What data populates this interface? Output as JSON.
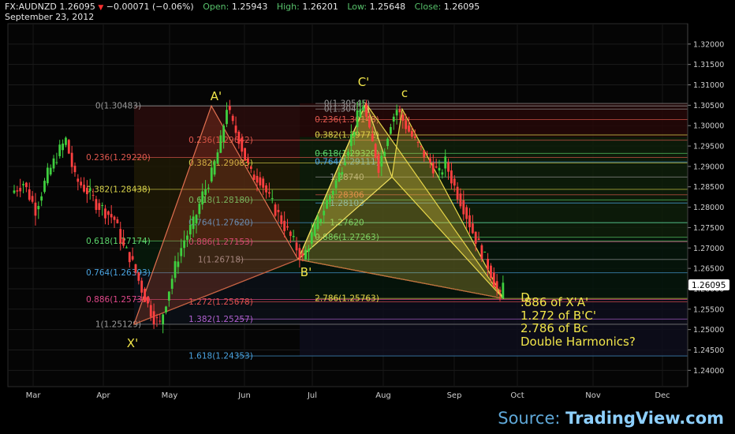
{
  "header": {
    "symbol": "FX:AUDNZD",
    "price": "1.26095",
    "change": "−0.00071 (−0.06%)",
    "open_label": "Open:",
    "open": "1.25943",
    "high_label": "High:",
    "high": "1.26201",
    "low_label": "Low:",
    "low": "1.25648",
    "close_label": "Close:",
    "close": "1.26095",
    "date": "September 23, 2012"
  },
  "price_tag": "1.26095",
  "colors": {
    "up": "#3fcf3f",
    "down": "#ff4040",
    "bull_pattern": "#e8d84a",
    "bear_pattern": "#cf6a3e",
    "price_tag_bg": "#ffffff"
  },
  "chart_data": {
    "type": "candlestick",
    "x_axis": {
      "ticks": [
        "Mar",
        "Apr",
        "May",
        "Jun",
        "Jul",
        "Aug",
        "Sep",
        "Oct",
        "Nov",
        "Dec"
      ]
    },
    "y_axis": {
      "min": 1.236,
      "max": 1.325,
      "ticks": [
        "1.32000",
        "1.31500",
        "1.31000",
        "1.30500",
        "1.30000",
        "1.29500",
        "1.29000",
        "1.28500",
        "1.28000",
        "1.27500",
        "1.27000",
        "1.26500",
        "1.26000",
        "1.25500",
        "1.25000",
        "1.24500",
        "1.24000"
      ]
    },
    "price_path": [
      [
        1.2835,
        0
      ],
      [
        1.286,
        4
      ],
      [
        1.2795,
        8
      ],
      [
        1.288,
        12
      ],
      [
        1.294,
        16
      ],
      [
        1.2965,
        18
      ],
      [
        1.287,
        21
      ],
      [
        1.284,
        25
      ],
      [
        1.281,
        28
      ],
      [
        1.279,
        31
      ],
      [
        1.277,
        34
      ],
      [
        1.27,
        37
      ],
      [
        1.268,
        39
      ],
      [
        1.264,
        41
      ],
      [
        1.26,
        43
      ],
      [
        1.256,
        45
      ],
      [
        1.253,
        47
      ],
      [
        1.2513,
        49
      ],
      [
        1.26,
        52
      ],
      [
        1.268,
        55
      ],
      [
        1.272,
        57
      ],
      [
        1.276,
        60
      ],
      [
        1.283,
        63
      ],
      [
        1.288,
        66
      ],
      [
        1.296,
        69
      ],
      [
        1.3048,
        71
      ],
      [
        1.3,
        73
      ],
      [
        1.297,
        75
      ],
      [
        1.292,
        77
      ],
      [
        1.288,
        79
      ],
      [
        1.287,
        82
      ],
      [
        1.282,
        85
      ],
      [
        1.278,
        88
      ],
      [
        1.274,
        91
      ],
      [
        1.27,
        94
      ],
      [
        1.2672,
        96
      ],
      [
        1.273,
        99
      ],
      [
        1.278,
        102
      ],
      [
        1.283,
        105
      ],
      [
        1.288,
        108
      ],
      [
        1.295,
        111
      ],
      [
        1.302,
        114
      ],
      [
        1.3054,
        116
      ],
      [
        1.298,
        118
      ],
      [
        1.293,
        120
      ],
      [
        1.29,
        121
      ],
      [
        1.295,
        123
      ],
      [
        1.301,
        125
      ],
      [
        1.304,
        127
      ],
      [
        1.3,
        130
      ],
      [
        1.296,
        133
      ],
      [
        1.293,
        136
      ],
      [
        1.29,
        139
      ],
      [
        1.288,
        141
      ],
      [
        1.291,
        143
      ],
      [
        1.285,
        146
      ],
      [
        1.28,
        149
      ],
      [
        1.274,
        152
      ],
      [
        1.269,
        155
      ],
      [
        1.264,
        158
      ],
      [
        1.2576,
        161
      ],
      [
        1.2609,
        162
      ]
    ],
    "fib_sets": [
      {
        "levels": [
          {
            "label": "0(1.30483)",
            "ratio": "0",
            "value": 1.30483,
            "color": "#9a9a9a"
          },
          {
            "label": "0.236(1.29220)",
            "value": 1.2922,
            "color": "#e0584e"
          },
          {
            "label": "0.382(1.28438)",
            "value": 1.28438,
            "color": "#d8d24a"
          },
          {
            "label": "0.618(1.27174)",
            "value": 1.27174,
            "color": "#5cd66c"
          },
          {
            "label": "0.764(1.26393)",
            "value": 1.26393,
            "color": "#4aa3e0"
          },
          {
            "label": "0.886(1.25739)",
            "value": 1.25739,
            "color": "#e0488a"
          },
          {
            "label": "1(1.25129)",
            "value": 1.25129,
            "color": "#9a9a9a"
          }
        ]
      },
      {
        "levels": [
          {
            "label": "0.236(1.29642)",
            "value": 1.29642,
            "color": "#e0584e"
          },
          {
            "label": "0.382(1.29083)",
            "value": 1.29083,
            "color": "#d8d24a"
          },
          {
            "label": "0.618(1.28180)",
            "value": 1.2818,
            "color": "#5cd66c"
          },
          {
            "label": "0.764(1.27620)",
            "value": 1.2762,
            "color": "#4aa3e0"
          },
          {
            "label": "0.886(1.27153)",
            "value": 1.27153,
            "color": "#e0488a"
          },
          {
            "label": "1(1.26718)",
            "value": 1.26718,
            "color": "#9a9a9a"
          },
          {
            "label": "1.272(1.25678)",
            "value": 1.25678,
            "color": "#e05050"
          },
          {
            "label": "1.382(1.25257)",
            "value": 1.25257,
            "color": "#b060d0"
          },
          {
            "label": "1.618(1.24353)",
            "value": 1.24353,
            "color": "#4aa3e0"
          }
        ]
      },
      {
        "levels": [
          {
            "label": "0(1.30545)",
            "value": 1.30545,
            "color": "#9a9a9a"
          },
          {
            "label": "0(1.30406)",
            "value": 1.30406,
            "color": "#9a9a9a"
          },
          {
            "label": "0.236(1.30148)",
            "value": 1.30148,
            "color": "#e0584e"
          },
          {
            "label": "0.382(1.29772)",
            "value": 1.29772,
            "color": "#d8d24a"
          },
          {
            "label": "0.618(1.29320)",
            "value": 1.2932,
            "color": "#5cd66c"
          },
          {
            "label": "0.764(1.29111)",
            "value": 1.29111,
            "color": "#4aa3e0"
          },
          {
            "label": "1.28740",
            "value": 1.2874,
            "color": "#9a9a9a"
          },
          {
            "label": "1.28306",
            "value": 1.28306,
            "color": "#e0584e"
          },
          {
            "label": "1.28103",
            "value": 1.28103,
            "color": "#4aa3e0"
          },
          {
            "label": "1.27620",
            "value": 1.2762,
            "color": "#5cd66c"
          },
          {
            "label": "0.886(1.27263)",
            "value": 1.27263,
            "color": "#5cd66c"
          },
          {
            "label": "2.786(1.25763)",
            "value": 1.25763,
            "color": "#e8d84a"
          }
        ]
      }
    ],
    "pattern_points": [
      {
        "label": "X'",
        "value": 1.25129
      },
      {
        "label": "A'",
        "value": 1.30483
      },
      {
        "label": "B'",
        "value": 1.26718
      },
      {
        "label": "C'",
        "value": 1.30545
      },
      {
        "label": "c",
        "value": 1.30406
      },
      {
        "label": "D",
        "value": 1.25763
      }
    ],
    "annotations": [
      ".886 of X'A'",
      "1.272 of B'C'",
      "2.786 of Bc",
      "Double Harmonics?"
    ]
  },
  "source": {
    "prefix": "Source: ",
    "brand": "TradingView.com"
  }
}
